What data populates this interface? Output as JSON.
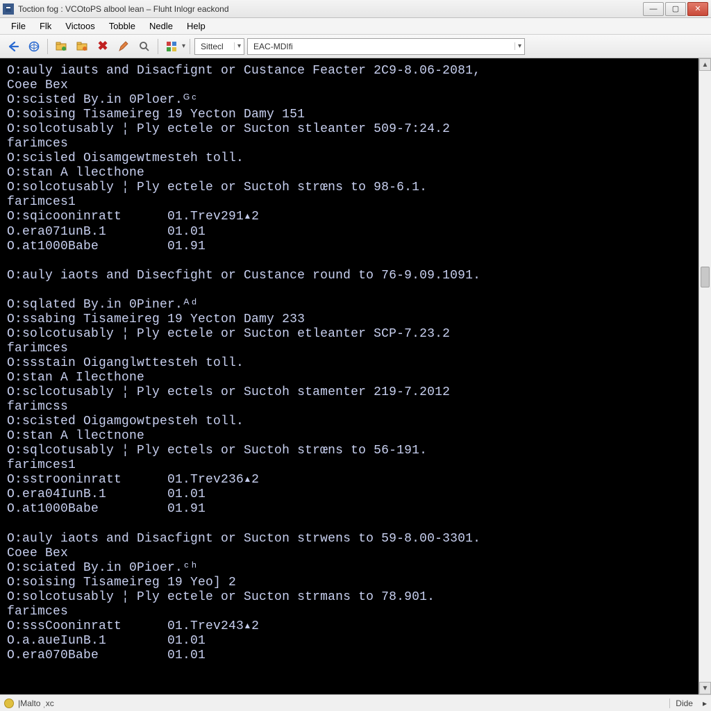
{
  "window": {
    "title": "Toction fog : VCOtoPS albool lean – Fluht Inlogr eackond"
  },
  "menu": {
    "items": [
      "File",
      "Flk",
      "Victoos",
      "Tobble",
      "Nedle",
      "Help"
    ]
  },
  "toolbar": {
    "combo1": "Sittecl",
    "combo2": "EAC-MDIfi"
  },
  "terminal": {
    "lines": [
      "O:auly iauts and Disacfignt or Custance Feacter 2C9-8.06-2081,",
      "Coee Bex",
      "O:scisted By.in 0Ploer.ᴳᶜ",
      "O:soising Tisameireg 19 Yecton Damy 151",
      "O:solcotusably ¦ Ply ectele or Sucton stleanter 509-7:24.2",
      "farimces",
      "O:scisled Oisamgewtmesteh toll.",
      "O:stan A llecthone",
      "O:solcotusably ¦ Ply ectele or Suctoh strœns to 98-6.1.",
      "farimces1",
      "O:sqicooninratt      01.Trev291▴2",
      "O.era071unB.1        01.01",
      "O.at1000Babe         01.91",
      "",
      "O:auly iaots and Disecfight or Custance round to 76-9.09.1091.",
      "",
      "O:sqlated By.in 0Piner.ᴬᵈ",
      "O:ssabing Tisameireg 19 Yecton Damy 233",
      "O:solcotusably ¦ Ply ectele or Sucton etleanter SCP-7.23.2",
      "farimces",
      "O:ssstain Oiganglwttesteh toll.",
      "O:stan A Ilecthone",
      "O:sclcotusably ¦ Ply ectels or Suctoh stamenter 219-7.2012",
      "farimcss",
      "O:scisted Oigamgowtpesteh toll.",
      "O:stan A llectnone",
      "O:sqlcotusably ¦ Ply ectels or Suctoh strœns to 56-191.",
      "farimces1",
      "O:sstrooninratt      01.Trev236▴2",
      "O.era04IunB.1        01.01",
      "O.at1000Babe         01.91",
      "",
      "O:auly iaots and Disacfignt or Sucton strwens to 59-8.00-3301.",
      "Coee Bex",
      "O:sciated By.in 0Pioer.ᶜʰ",
      "O:soising Tisameireg 19 Yeo] 2",
      "O:solcotusably ¦ Ply ectele or Sucton strmans to 78.901.",
      "farimces",
      "O:sssCooninratt      01.Trev243▴2",
      "O.a.aueIunB.1        01.01",
      "O.era070Babe         01.01"
    ]
  },
  "statusbar": {
    "left": "|Malto ˌxc",
    "right": "Dide"
  }
}
